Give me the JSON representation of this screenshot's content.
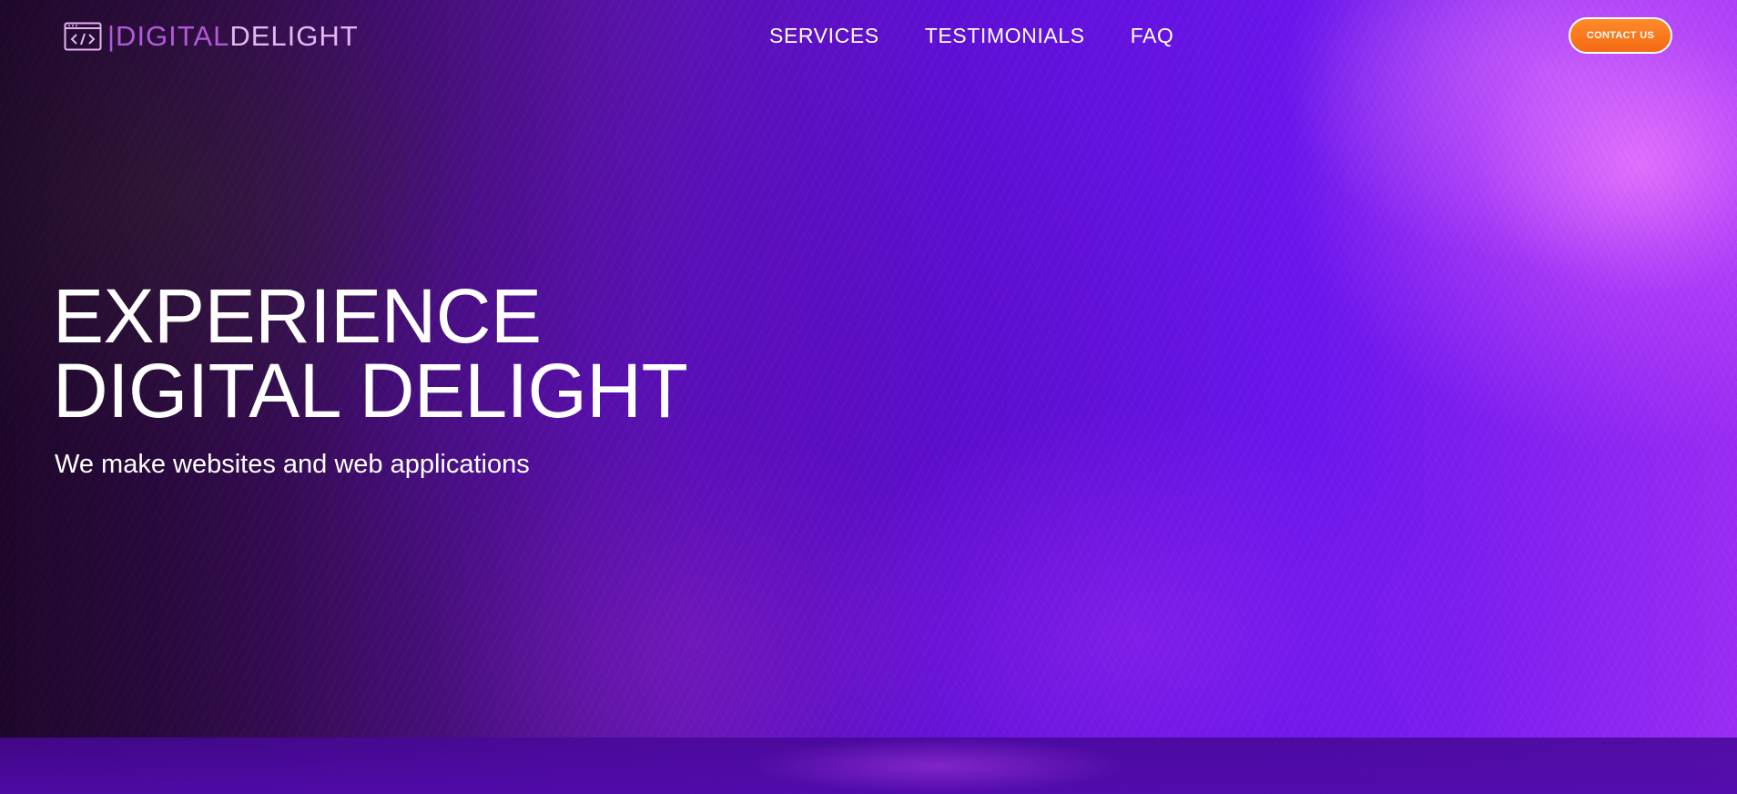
{
  "header": {
    "logo": {
      "icon": "code-window-icon",
      "text_part_1": "|DIGITAL",
      "text_part_2": "DELIGHT"
    },
    "nav": [
      {
        "label": "SERVICES"
      },
      {
        "label": "TESTIMONIALS"
      },
      {
        "label": "FAQ"
      }
    ],
    "contact_button": "CONTACT US"
  },
  "hero": {
    "title_line_1": "EXPERIENCE",
    "title_line_2": "DIGITAL DELIGHT",
    "subtitle": "We make websites and web applications"
  },
  "colors": {
    "accent_orange": "#f36a13",
    "logo_purple": "#b05ad8",
    "logo_light": "#e3b6f2",
    "background_purple": "#5f0fd6"
  }
}
